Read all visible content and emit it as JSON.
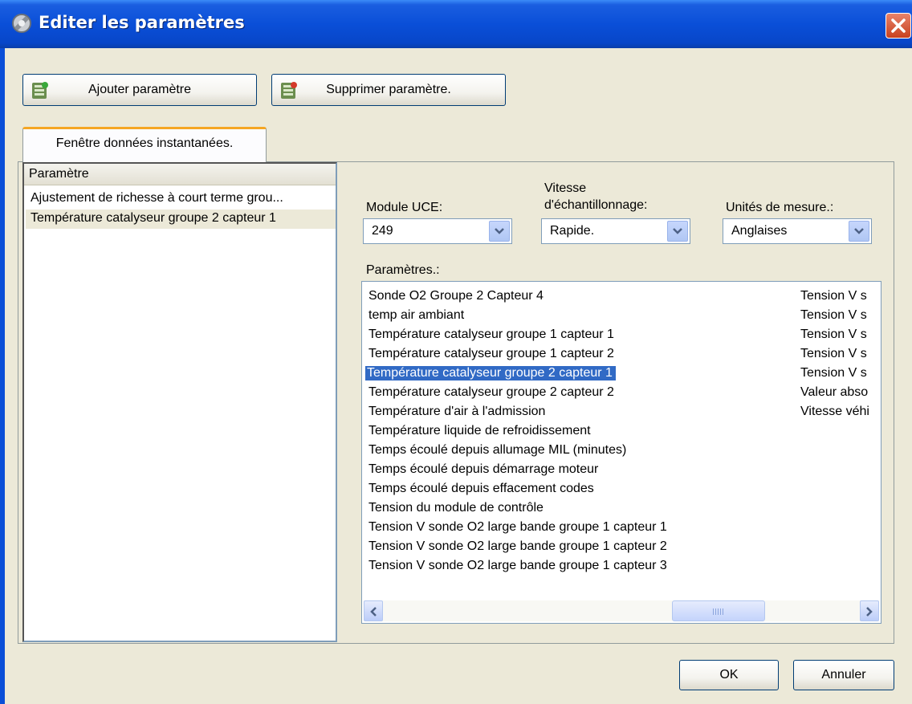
{
  "window": {
    "title": "Editer les paramètres"
  },
  "toolbar": {
    "add_label": "Ajouter paramètre",
    "remove_label": "Supprimer paramètre."
  },
  "tab": {
    "label": "Fenêtre données instantanées."
  },
  "left_list": {
    "header": "Paramètre",
    "items": [
      "Ajustement  de richesse à court terme grou...",
      "Température catalyseur groupe 2 capteur 1"
    ],
    "selected_index": 1
  },
  "fields": {
    "module_label": "Module UCE:",
    "module_value": "249",
    "speed_label_1": "Vitesse",
    "speed_label_2": "d'échantillonnage:",
    "speed_value": "Rapide.",
    "units_label": "Unités de mesure.:",
    "units_value": "Anglaises"
  },
  "params": {
    "label": "Paramètres.:",
    "rows": [
      {
        "name": "Sonde O2 Groupe 2 Capteur 4",
        "unit": "Tension V s"
      },
      {
        "name": "temp air ambiant",
        "unit": "Tension V s"
      },
      {
        "name": "Température catalyseur groupe 1 capteur 1",
        "unit": "Tension V s"
      },
      {
        "name": "Température catalyseur groupe 1 capteur 2",
        "unit": "Tension V s"
      },
      {
        "name": "Température catalyseur groupe 2 capteur 1",
        "unit": "Tension V s"
      },
      {
        "name": "Température catalyseur groupe 2 capteur 2",
        "unit": "Valeur abso"
      },
      {
        "name": "Température d'air à l'admission",
        "unit": "Vitesse véhi"
      },
      {
        "name": "Température liquide de refroidissement",
        "unit": ""
      },
      {
        "name": "Temps écoulé depuis allumage MIL (minutes)",
        "unit": ""
      },
      {
        "name": "Temps écoulé depuis démarrage moteur",
        "unit": ""
      },
      {
        "name": "Temps écoulé depuis effacement codes",
        "unit": ""
      },
      {
        "name": "Tension du module de contrôle",
        "unit": ""
      },
      {
        "name": "Tension V sonde O2 large bande groupe 1 capteur 1",
        "unit": ""
      },
      {
        "name": "Tension V sonde O2 large bande groupe 1 capteur 2",
        "unit": ""
      },
      {
        "name": "Tension V sonde O2 large bande groupe 1 capteur 3",
        "unit": ""
      }
    ],
    "selected_index": 4
  },
  "dialog": {
    "ok_label": "OK",
    "cancel_label": "Annuler"
  }
}
